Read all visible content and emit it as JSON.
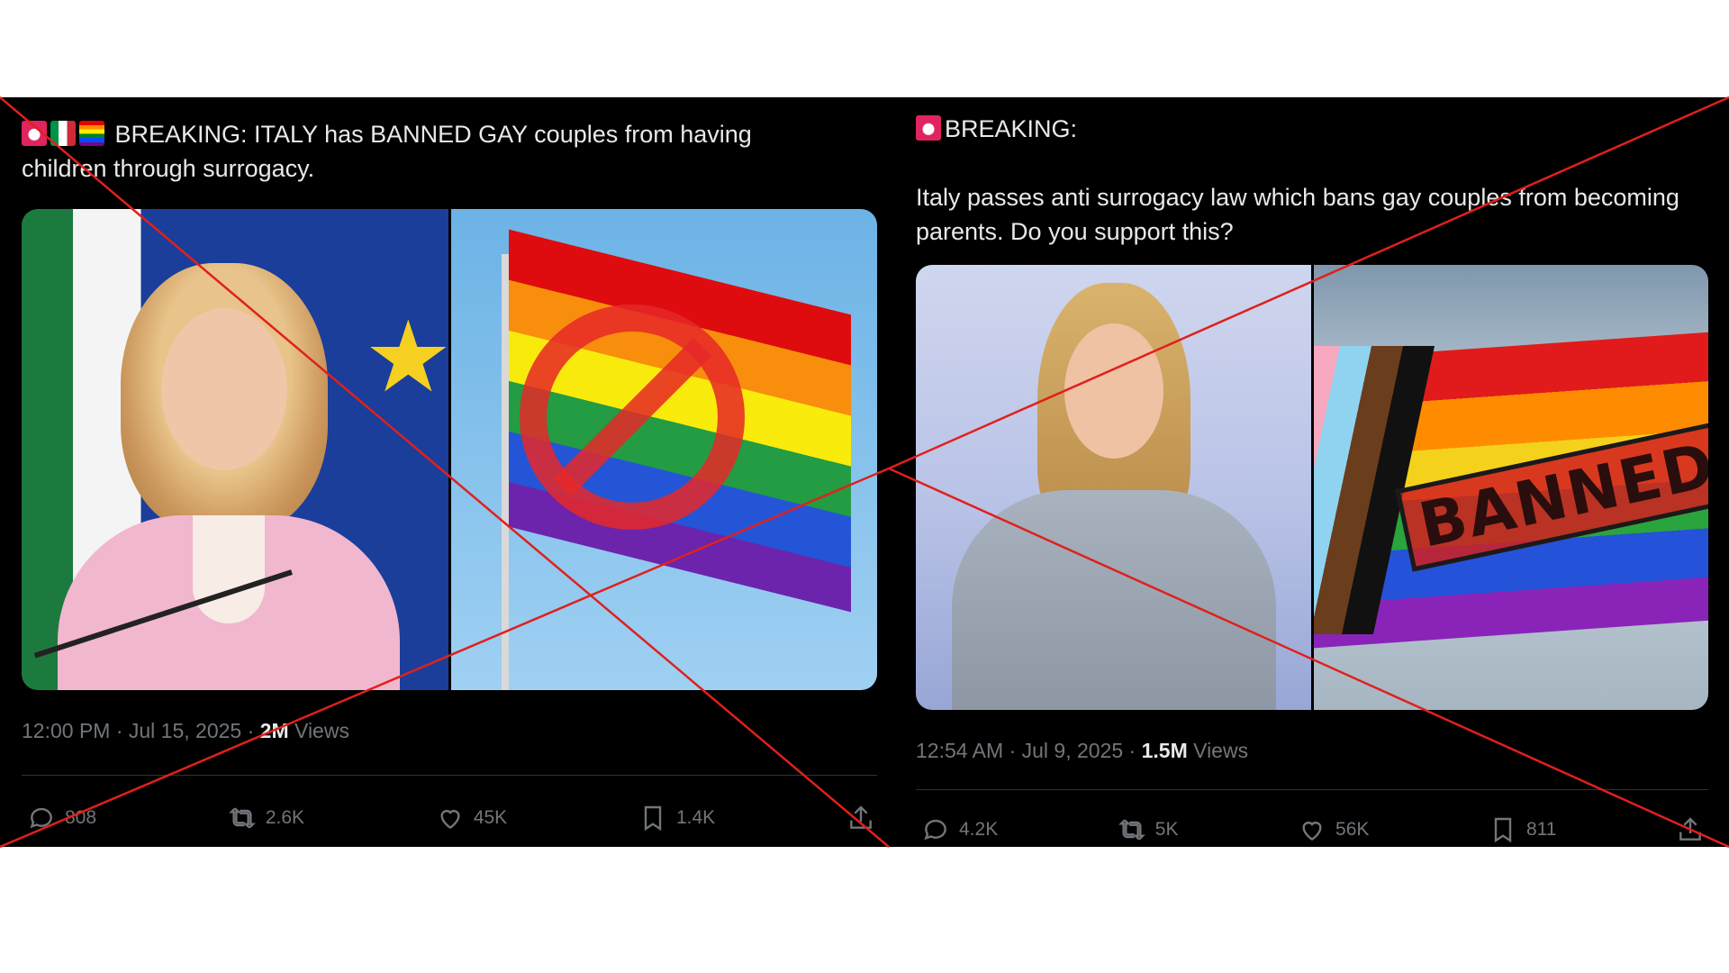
{
  "tweets": [
    {
      "text_line1": "BREAKING: ITALY has BANNED GAY couples from having",
      "text_line2": "children through surrogacy.",
      "emojis": [
        "police-light-icon",
        "italy-flag-icon",
        "rainbow-flag-icon"
      ],
      "time": "12:00 PM · Jul 15, 2025",
      "views_count": "2M",
      "views_label": "Views",
      "replies": "808",
      "reposts": "2.6K",
      "likes": "45K",
      "bookmarks": "1.4K"
    },
    {
      "text_line1": "BREAKING:",
      "text_line2": "Italy passes anti surrogacy law which bans gay couples from becoming parents. Do you support this?",
      "emojis": [
        "police-light-icon"
      ],
      "time": "12:54 AM · Jul 9, 2025",
      "views_count": "1.5M",
      "views_label": "Views",
      "replies": "4.2K",
      "reposts": "5K",
      "likes": "56K",
      "bookmarks": "811",
      "banner_text": "BANNED"
    }
  ],
  "colors": {
    "background": "#000000",
    "text": "#e7e9ea",
    "muted": "#71767b",
    "cross": "#e0201c"
  }
}
